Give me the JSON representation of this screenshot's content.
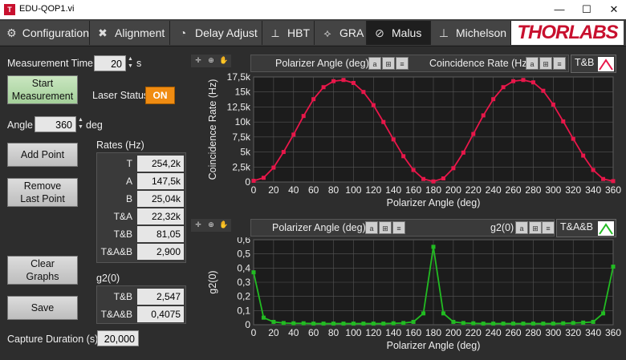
{
  "window": {
    "title": "EDU-QOP1.vi",
    "minimize": "—",
    "maximize": "☐",
    "close": "✕"
  },
  "tabs": [
    {
      "label": "Configuration",
      "icon": "gear-icon"
    },
    {
      "label": "Alignment",
      "icon": "tools-icon"
    },
    {
      "label": "Delay Adjust",
      "icon": "clock-icon"
    },
    {
      "label": "HBT",
      "icon": "hbt-diagram-icon"
    },
    {
      "label": "GRA",
      "icon": "gra-diagram-icon"
    },
    {
      "label": "Malus",
      "icon": "polarizer-icon"
    },
    {
      "label": "Michelson",
      "icon": "michelson-diagram-icon"
    }
  ],
  "brand": "THORLABS",
  "controls": {
    "measurement_time_label": "Measurement Time",
    "measurement_time_value": "20",
    "measurement_time_unit": "s",
    "start_button": "Start\nMeasurement",
    "laser_status_label": "Laser Status",
    "laser_status_value": "ON",
    "angle_label": "Angle",
    "angle_value": "360",
    "angle_unit": "deg",
    "add_point": "Add Point",
    "remove_last_point": "Remove\nLast Point",
    "clear_graphs": "Clear\nGraphs",
    "save": "Save",
    "capture_duration_label": "Capture Duration (s)",
    "capture_duration_value": "20,000"
  },
  "rates": {
    "title": "Rates (Hz)",
    "rows": [
      {
        "label": "T",
        "value": "254,2k"
      },
      {
        "label": "A",
        "value": "147,5k"
      },
      {
        "label": "B",
        "value": "25,04k"
      },
      {
        "label": "T&A",
        "value": "22,32k"
      },
      {
        "label": "T&B",
        "value": "81,05"
      },
      {
        "label": "T&A&B",
        "value": "2,900"
      }
    ]
  },
  "g2": {
    "title": "g2(0)",
    "rows": [
      {
        "label": "T&B",
        "value": "2,547"
      },
      {
        "label": "T&A&B",
        "value": "0,4075"
      }
    ]
  },
  "colors": {
    "curve1": "#e8174a",
    "curve2": "#22bb22",
    "accent": "#f08c12",
    "brand": "#c8102e"
  },
  "chart_data": [
    {
      "type": "line",
      "x_bar_label": "Polarizer Angle (deg)",
      "y_bar_label": "Coincidence Rate (Hz)",
      "legend": "T&B",
      "xlabel": "Polarizer Angle (deg)",
      "ylabel": "Coincidence Rate (Hz)",
      "xlim": [
        0,
        360
      ],
      "ylim": [
        0,
        17500
      ],
      "x_ticks": [
        0,
        20,
        40,
        60,
        80,
        100,
        120,
        140,
        160,
        180,
        200,
        220,
        240,
        260,
        280,
        300,
        320,
        340,
        360
      ],
      "y_ticks": [
        0,
        2500,
        5000,
        7500,
        10000,
        12500,
        15000,
        17500
      ],
      "y_tick_labels": [
        "0",
        "2,5k",
        "5k",
        "7,5k",
        "10k",
        "12,5k",
        "15k",
        "17,5k"
      ],
      "x": [
        0,
        10,
        20,
        30,
        40,
        50,
        60,
        70,
        80,
        90,
        100,
        110,
        120,
        130,
        140,
        150,
        160,
        170,
        180,
        190,
        200,
        210,
        220,
        230,
        240,
        250,
        260,
        270,
        280,
        290,
        300,
        310,
        320,
        330,
        340,
        350,
        360
      ],
      "values": [
        200,
        700,
        2400,
        5000,
        7900,
        11000,
        13800,
        15800,
        16800,
        17000,
        16500,
        15000,
        12800,
        10000,
        7100,
        4300,
        2000,
        500,
        100,
        600,
        2300,
        4900,
        8000,
        11100,
        13800,
        15800,
        16800,
        17000,
        16600,
        15200,
        12900,
        10100,
        7200,
        4400,
        2000,
        500,
        150
      ]
    },
    {
      "type": "line",
      "x_bar_label": "Polarizer Angle (deg)",
      "y_bar_label": "g2(0)",
      "legend": "T&A&B",
      "xlabel": "Polarizer Angle (deg)",
      "ylabel": "g2(0)",
      "xlim": [
        0,
        360
      ],
      "ylim": [
        0,
        0.6
      ],
      "x_ticks": [
        0,
        20,
        40,
        60,
        80,
        100,
        120,
        140,
        160,
        180,
        200,
        220,
        240,
        260,
        280,
        300,
        320,
        340,
        360
      ],
      "y_ticks": [
        0,
        0.1,
        0.2,
        0.3,
        0.4,
        0.5,
        0.6
      ],
      "y_tick_labels": [
        "0",
        "0,1",
        "0,2",
        "0,3",
        "0,4",
        "0,5",
        "0,6"
      ],
      "x": [
        0,
        10,
        20,
        30,
        40,
        50,
        60,
        70,
        80,
        90,
        100,
        110,
        120,
        130,
        140,
        150,
        160,
        170,
        180,
        190,
        200,
        210,
        220,
        230,
        240,
        250,
        260,
        270,
        280,
        290,
        300,
        310,
        320,
        330,
        340,
        350,
        360
      ],
      "values": [
        0.37,
        0.05,
        0.02,
        0.012,
        0.01,
        0.01,
        0.008,
        0.008,
        0.008,
        0.008,
        0.008,
        0.008,
        0.008,
        0.008,
        0.01,
        0.012,
        0.02,
        0.08,
        0.55,
        0.08,
        0.02,
        0.012,
        0.01,
        0.008,
        0.008,
        0.008,
        0.008,
        0.008,
        0.008,
        0.008,
        0.008,
        0.01,
        0.012,
        0.015,
        0.02,
        0.08,
        0.41
      ]
    }
  ]
}
